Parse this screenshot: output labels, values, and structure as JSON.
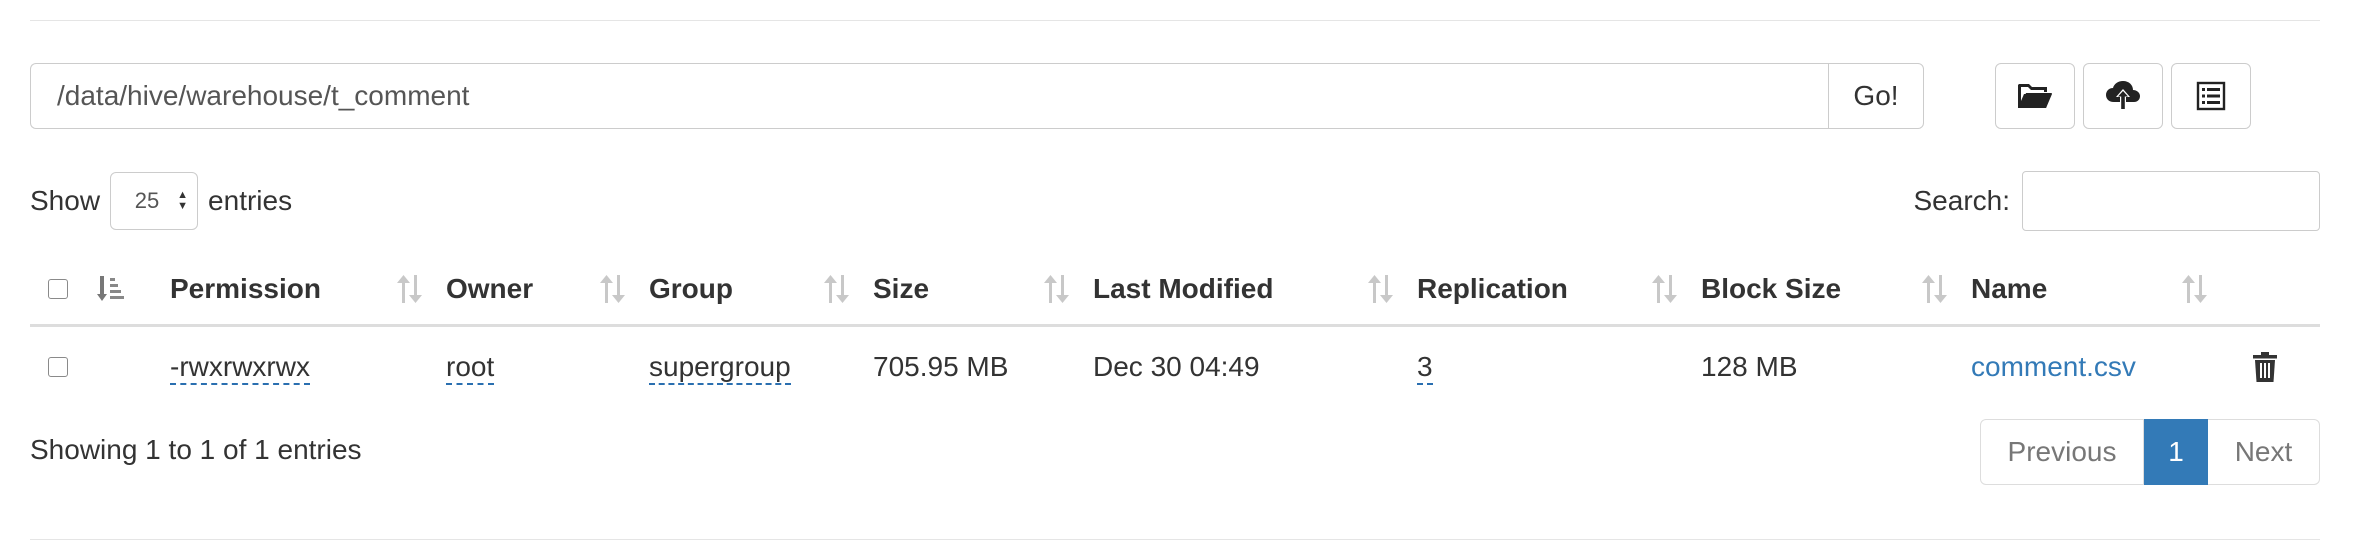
{
  "path_bar": {
    "path": "/data/hive/warehouse/t_comment",
    "go_label": "Go!"
  },
  "toolbar": {
    "icons": [
      "open-folder-icon",
      "upload-cloud-icon",
      "list-icon"
    ]
  },
  "length": {
    "show_label": "Show",
    "value": "25",
    "entries_label": "entries"
  },
  "search": {
    "label": "Search:",
    "value": ""
  },
  "table": {
    "columns": [
      "Permission",
      "Owner",
      "Group",
      "Size",
      "Last Modified",
      "Replication",
      "Block Size",
      "Name"
    ],
    "rows": [
      {
        "permission": "-rwxrwxrwx",
        "owner": "root",
        "group": "supergroup",
        "size": "705.95 MB",
        "modified": "Dec 30 04:49",
        "replication": "3",
        "block_size": "128 MB",
        "name": "comment.csv"
      }
    ]
  },
  "info": "Showing 1 to 1 of 1 entries",
  "pagination": {
    "previous": "Previous",
    "current": "1",
    "next": "Next"
  },
  "colors": {
    "accent": "#337ab7",
    "border": "#cccccc",
    "text": "#333333"
  }
}
